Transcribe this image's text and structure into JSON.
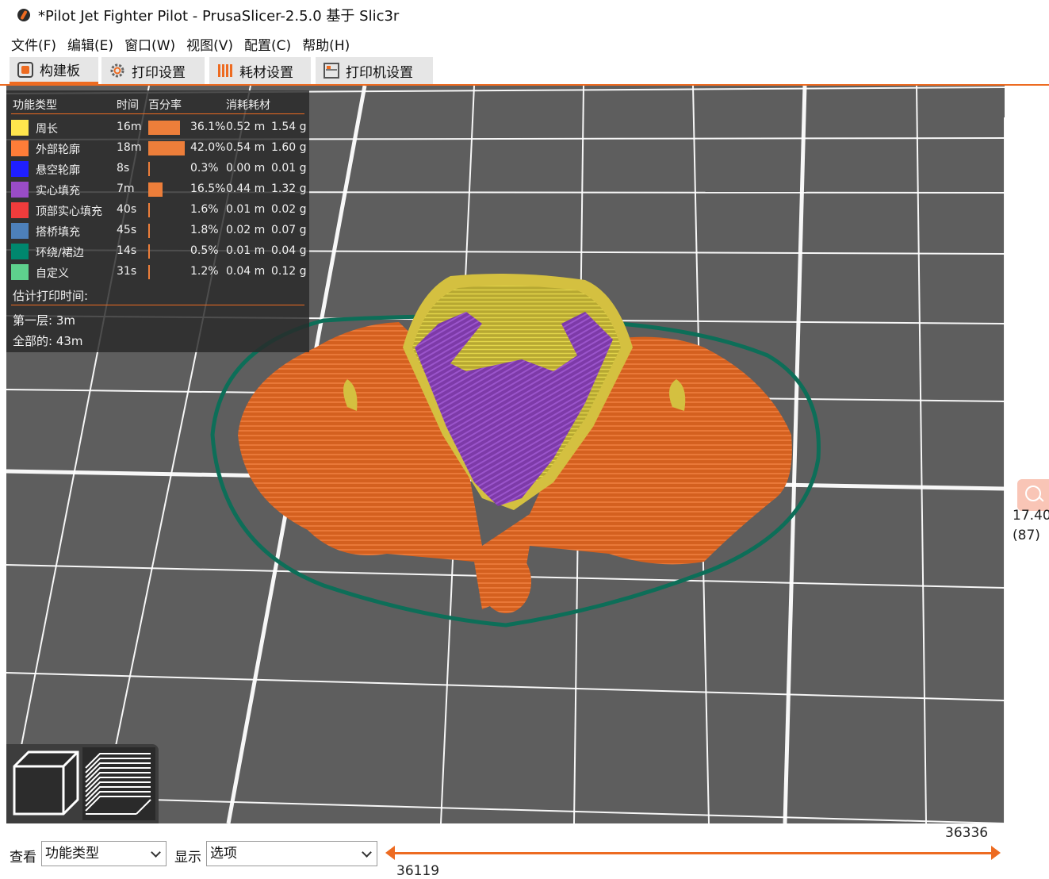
{
  "window": {
    "title": "*Pilot Jet Fighter Pilot - PrusaSlicer-2.5.0 基于 Slic3r"
  },
  "menu": [
    "文件(F)",
    "编辑(E)",
    "窗口(W)",
    "视图(V)",
    "配置(C)",
    "帮助(H)"
  ],
  "tabs": [
    {
      "label": "构建板",
      "icon": "plater-icon",
      "active": true
    },
    {
      "label": "打印设置",
      "icon": "gear-icon",
      "active": false
    },
    {
      "label": "耗材设置",
      "icon": "filament-icon",
      "active": false
    },
    {
      "label": "打印机设置",
      "icon": "printer-icon",
      "active": false
    }
  ],
  "legend": {
    "headers": {
      "type": "功能类型",
      "time": "时间",
      "percent": "百分率",
      "used": "消耗耗材"
    },
    "rows": [
      {
        "name": "周长",
        "color": "#ffe64d",
        "time": "16m",
        "percent": "36.1%",
        "pct_value": 36.1,
        "length": "0.52 m",
        "weight": "1.54 g"
      },
      {
        "name": "外部轮廓",
        "color": "#ff7d38",
        "time": "18m",
        "percent": "42.0%",
        "pct_value": 42.0,
        "length": "0.54 m",
        "weight": "1.60 g"
      },
      {
        "name": "悬空轮廓",
        "color": "#1f1fff",
        "time": "8s",
        "percent": "0.3%",
        "pct_value": 0.3,
        "length": "0.00 m",
        "weight": "0.01 g"
      },
      {
        "name": "实心填充",
        "color": "#9a4cc7",
        "time": "7m",
        "percent": "16.5%",
        "pct_value": 16.5,
        "length": "0.44 m",
        "weight": "1.32 g"
      },
      {
        "name": "顶部实心填充",
        "color": "#f03c3c",
        "time": "40s",
        "percent": "1.6%",
        "pct_value": 1.6,
        "length": "0.01 m",
        "weight": "0.02 g"
      },
      {
        "name": "搭桥填充",
        "color": "#4d80ba",
        "time": "45s",
        "percent": "1.8%",
        "pct_value": 1.8,
        "length": "0.02 m",
        "weight": "0.07 g"
      },
      {
        "name": "环绕/裙边",
        "color": "#00876e",
        "time": "14s",
        "percent": "0.5%",
        "pct_value": 0.5,
        "length": "0.01 m",
        "weight": "0.04 g"
      },
      {
        "name": "自定义",
        "color": "#5ed18d",
        "time": "31s",
        "percent": "1.2%",
        "pct_value": 1.2,
        "length": "0.04 m",
        "weight": "0.12 g"
      }
    ],
    "estimate_title": "估计打印时间:",
    "first_layer": "第一层: 3m",
    "total": "全部的: 43m"
  },
  "side": {
    "zoom_icon": "search-icon",
    "value": "17.40",
    "layer": "(87)"
  },
  "view_buttons": [
    "3d-view-icon",
    "layers-view-icon"
  ],
  "bottom": {
    "view_label": "查看",
    "view_value": "功能类型",
    "show_label": "显示",
    "show_value": "选项",
    "slider_max": "36336",
    "slider_min": "36119"
  },
  "colors": {
    "accent": "#ed6b21",
    "viewport": "#5e5e5e"
  }
}
